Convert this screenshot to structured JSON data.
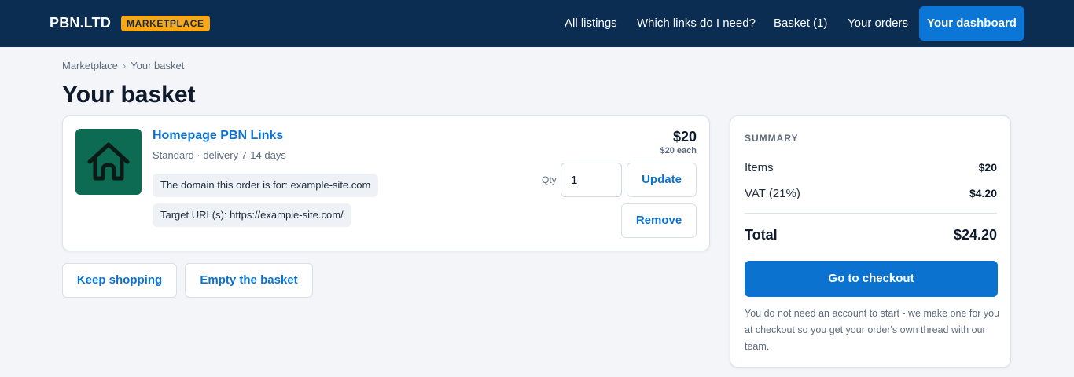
{
  "header": {
    "brand": "PBN.LTD",
    "badge": "MARKETPLACE",
    "nav": {
      "all_listings": "All listings",
      "which_links": "Which links do I need?",
      "basket": "Basket (1)",
      "your_orders": "Your orders",
      "dashboard": "Your dashboard"
    }
  },
  "breadcrumb": {
    "root": "Marketplace",
    "separator": "›",
    "current": "Your basket"
  },
  "page": {
    "title": "Your basket"
  },
  "basket_item": {
    "icon": "house-icon",
    "title": "Homepage PBN Links",
    "subtitle": "Standard · delivery 7-14 days",
    "domain_chip": "The domain this order is for: example-site.com",
    "target_chip": "Target URL(s): https://example-site.com/",
    "price": "$20",
    "price_each": "$20 each",
    "qty_label": "Qty",
    "qty_value": "1",
    "update_label": "Update",
    "remove_label": "Remove"
  },
  "actions": {
    "keep_shopping": "Keep shopping",
    "empty_basket": "Empty the basket"
  },
  "summary": {
    "heading": "SUMMARY",
    "items_label": "Items",
    "items_value": "$20",
    "vat_label": "VAT (21%)",
    "vat_value": "$4.20",
    "total_label": "Total",
    "total_value": "$24.20",
    "checkout_label": "Go to checkout",
    "note": "You do not need an account to start - we make one for you at checkout so you get your order's own thread with our team."
  },
  "colors": {
    "header_bg": "#0b2d52",
    "badge_bg": "#f5a91a",
    "accent": "#0b72d0",
    "thumb_bg": "#0e6b53",
    "page_bg": "#f3f5f8"
  }
}
